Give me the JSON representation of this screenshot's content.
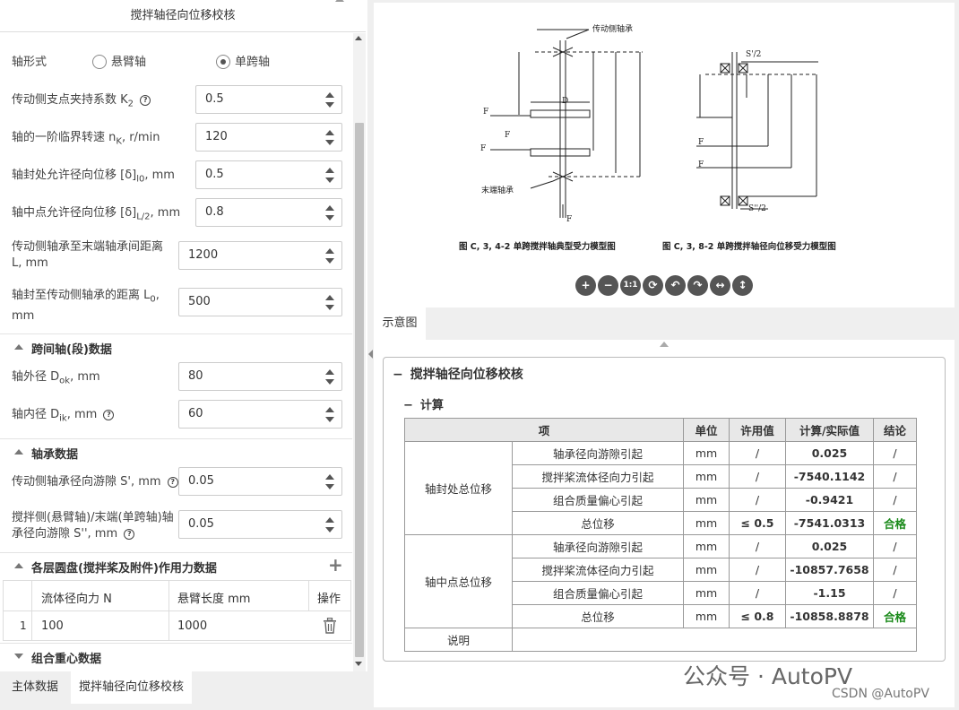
{
  "left_panel": {
    "title": "搅拌轴径向位移校核",
    "shaft_form": {
      "label": "轴形式",
      "options": [
        "悬臂轴",
        "单跨轴"
      ],
      "selected": "单跨轴"
    },
    "fields": [
      {
        "label": "传动侧支点夹持系数 K",
        "sub": "2",
        "help": true,
        "value": "0.5"
      },
      {
        "label": "轴的一阶临界转速 n",
        "sub": "K",
        "suffix": ", r/min",
        "value": "120"
      },
      {
        "label": "轴封处允许径向位移 [δ]",
        "sub": "l0",
        "suffix": ", mm",
        "value": "0.5"
      },
      {
        "label": "轴中点允许径向位移 [δ]",
        "sub": "L/2",
        "suffix": ", mm",
        "value": "0.8"
      },
      {
        "label": "传动侧轴承至末端轴承间距离",
        "line2": "L, mm",
        "value": "1200"
      },
      {
        "label": "轴封至传动侧轴承的距离 L",
        "sub": "0",
        "suffix": ",",
        "line2": "mm",
        "value": "500"
      }
    ],
    "section_span": "跨间轴(段)数据",
    "span_fields": [
      {
        "label": "轴外径 D",
        "sub": "ok",
        "suffix": ", mm",
        "value": "80"
      },
      {
        "label": "轴内径 D",
        "sub": "ik",
        "suffix": ", mm",
        "help": true,
        "value": "60"
      }
    ],
    "section_bearing": "轴承数据",
    "bearing_fields": [
      {
        "label": "传动侧轴承径向游隙 S', mm",
        "help": true,
        "value": "0.05"
      },
      {
        "label": "搅拌侧(悬臂轴)/末端(单跨轴)轴",
        "line2": "承径向游隙 S'', mm",
        "help2": true,
        "value": "0.05"
      }
    ],
    "section_disk": "各层圆盘(搅拌桨及附件)作用力数据",
    "disk_table": {
      "headers": [
        "流体径向力 N",
        "悬臂长度 mm",
        "操作"
      ],
      "rows": [
        {
          "idx": "1",
          "force": "100",
          "length": "1000"
        }
      ]
    },
    "section_cg": "组合重心数据",
    "bottom_tabs": [
      "主体数据",
      "搅拌轴径向位移校核"
    ]
  },
  "figure": {
    "caption1": "图 C, 3, 4-2    单跨搅拌轴典型受力模型图",
    "caption2": "图 C, 3, 8-2    单跨搅拌轴径向位移受力模型图",
    "label_drive_bearing": "传动侧轴承",
    "label_end_bearing": "末端轴承",
    "toolbar_icons": [
      "zoom-in-icon",
      "zoom-out-icon",
      "actual-size-icon",
      "reset-icon",
      "rotate-left-icon",
      "rotate-right-icon",
      "flip-horizontal-icon",
      "flip-vertical-icon"
    ],
    "toolbar_glyphs": [
      "+",
      "−",
      "1:1",
      "⟳",
      "↶",
      "↷",
      "↔",
      "↕"
    ],
    "tab_label": "示意图"
  },
  "calc": {
    "title": "搅拌轴径向位移校核",
    "subtitle": "计算",
    "headers": [
      "项",
      "单位",
      "许用值",
      "计算/实际值",
      "结论"
    ],
    "groups": [
      {
        "name": "轴封处总位移",
        "rows": [
          {
            "item": "轴承径向游隙引起",
            "unit": "mm",
            "allow": "/",
            "value": "0.025",
            "result": "/"
          },
          {
            "item": "搅拌桨流体径向力引起",
            "unit": "mm",
            "allow": "/",
            "value": "-7540.1142",
            "result": "/"
          },
          {
            "item": "组合质量偏心引起",
            "unit": "mm",
            "allow": "/",
            "value": "-0.9421",
            "result": "/"
          },
          {
            "item": "总位移",
            "unit": "mm",
            "allow": "≤ 0.5",
            "value": "-7541.0313",
            "result": "合格"
          }
        ]
      },
      {
        "name": "轴中点总位移",
        "rows": [
          {
            "item": "轴承径向游隙引起",
            "unit": "mm",
            "allow": "/",
            "value": "0.025",
            "result": "/"
          },
          {
            "item": "搅拌桨流体径向力引起",
            "unit": "mm",
            "allow": "/",
            "value": "-10857.7658",
            "result": "/"
          },
          {
            "item": "组合质量偏心引起",
            "unit": "mm",
            "allow": "/",
            "value": "-1.15",
            "result": "/"
          },
          {
            "item": "总位移",
            "unit": "mm",
            "allow": "≤ 0.8",
            "value": "-10858.8878",
            "result": "合格"
          }
        ]
      }
    ],
    "note_label": "说明"
  },
  "watermark": "公众号 · AutoPV",
  "csdn": "CSDN @AutoPV",
  "colors": {
    "pass": "#1a8a1a",
    "header_bg": "#e8e8e8"
  }
}
